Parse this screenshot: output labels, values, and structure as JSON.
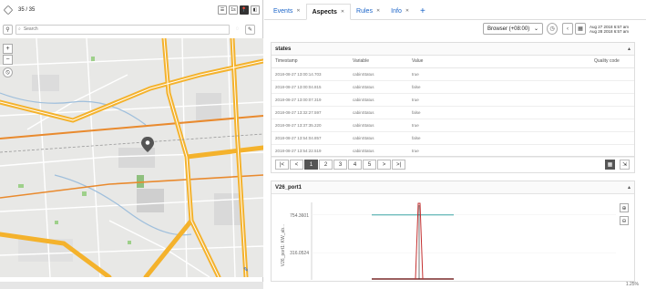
{
  "asset_panel": {
    "count": "35 / 35",
    "search_placeholder": "Search",
    "view_buttons": [
      "☰",
      "1s",
      "📍",
      "◧"
    ]
  },
  "tabs": [
    {
      "label": "Events"
    },
    {
      "label": "Aspects"
    },
    {
      "label": "Rules"
    },
    {
      "label": "Info"
    }
  ],
  "toolbar": {
    "timezone": "Browser (+08:00)",
    "date_from": "Aug 27 2018 6:57 am",
    "date_to": "Aug 28 2018 6:57 am"
  },
  "states": {
    "title": "states",
    "columns": [
      "Timestamp",
      "Variable",
      "Value",
      "Quality code"
    ],
    "rows": [
      [
        "2018-08-27 13:00:14.703",
        "cabinStatus",
        "true",
        ""
      ],
      [
        "2018-08-27 13:00:04.815",
        "cabinStatus",
        "false",
        ""
      ],
      [
        "2018-08-27 13:00:07.319",
        "cabinStatus",
        "true",
        ""
      ],
      [
        "2018-08-27 13:32:27.597",
        "cabinStatus",
        "false",
        ""
      ],
      [
        "2018-08-27 13:37:35.220",
        "cabinStatus",
        "true",
        ""
      ],
      [
        "2018-08-27 13:54:04.857",
        "cabinStatus",
        "false",
        ""
      ],
      [
        "2018-08-27 13:54:22.519",
        "cabinStatus",
        "true",
        ""
      ]
    ],
    "pages": [
      "1",
      "2",
      "3",
      "4",
      "5"
    ]
  },
  "chart_panel": {
    "title": "V26_port1",
    "chart_data": {
      "type": "line",
      "ylabel": "V26_port1: KW_ab...",
      "y_ticks": [
        "754.3601",
        "316.0524"
      ],
      "series": [
        {
          "color": "#3aa3a3",
          "values": [
            754,
            754,
            754,
            754,
            754,
            754
          ]
        },
        {
          "color": "#c43030",
          "values": [
            0,
            0,
            0,
            890,
            0,
            0
          ]
        }
      ]
    }
  },
  "statusbar": {
    "text": "1.25%"
  },
  "colors": {
    "accent": "#1a64c8",
    "map_road": "#f4b22c",
    "teal": "#3aa3a3",
    "red": "#c43030"
  }
}
